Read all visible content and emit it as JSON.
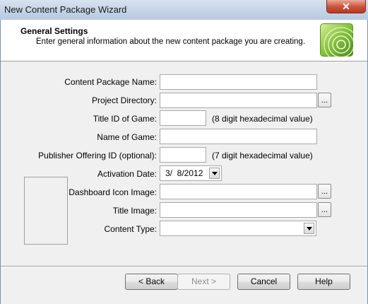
{
  "window": {
    "title": "New Content Package Wizard",
    "close_glyph": "✕"
  },
  "header": {
    "title": "General Settings",
    "subtitle": "Enter general information about the new content package you are creating.",
    "logo_icon": "xbox-orb-icon"
  },
  "form": {
    "content_package_name": {
      "label": "Content Package Name:",
      "value": ""
    },
    "project_directory": {
      "label": "Project Directory:",
      "value": "",
      "browse": "..."
    },
    "title_id": {
      "label": "Title ID of Game:",
      "value": "",
      "hint": "(8 digit hexadecimal value)"
    },
    "game_name": {
      "label": "Name of Game:",
      "value": ""
    },
    "publisher_offering_id": {
      "label": "Publisher Offering ID (optional):",
      "value": "",
      "hint": "(7 digit hexadecimal value)"
    },
    "activation_date": {
      "label": "Activation Date:",
      "value": "3/  8/2012"
    },
    "dashboard_icon": {
      "label": "Dashboard Icon Image:",
      "value": "",
      "browse": "..."
    },
    "title_image": {
      "label": "Title Image:",
      "value": "",
      "browse": "..."
    },
    "content_type": {
      "label": "Content Type:",
      "value": ""
    }
  },
  "buttons": {
    "back": "< Back",
    "next": "Next >",
    "cancel": "Cancel",
    "help": "Help"
  }
}
